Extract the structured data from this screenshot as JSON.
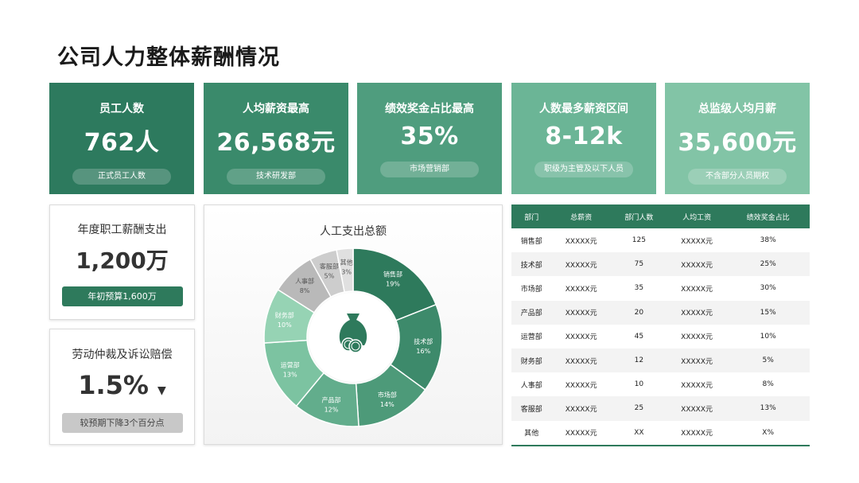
{
  "title": "公司人力整体薪酬情况",
  "kpis": [
    {
      "label": "员工人数",
      "value": "762人",
      "note": "正式员工人数",
      "color": "#2d7a5e"
    },
    {
      "label": "人均薪资最高",
      "value": "26,568元",
      "note": "技术研发部",
      "color": "#3a8a6b"
    },
    {
      "label": "绩效奖金占比最高",
      "value": "35%",
      "note": "市场营销部",
      "color": "#4f9d7e"
    },
    {
      "label": "人数最多薪资区间",
      "value": "8-12k",
      "note": "职级为主管及以下人员",
      "color": "#6bb596"
    },
    {
      "label": "总监级人均月薪",
      "value": "35,600元",
      "note": "不含部分人员期权",
      "color": "#82c4a6"
    }
  ],
  "annual": {
    "label": "年度职工薪酬支出",
    "value": "1,200万",
    "note": "年初预算1,600万"
  },
  "labor": {
    "label": "劳动仲裁及诉讼赔偿",
    "value": "1.5%",
    "arrow": "▼",
    "note": "较预期下降3个百分点"
  },
  "chart_data": {
    "type": "pie",
    "title": "人工支出总额",
    "categories": [
      "销售部",
      "技术部",
      "市场部",
      "产品部",
      "运营部",
      "财务部",
      "人事部",
      "客服部",
      "其他"
    ],
    "values": [
      19,
      16,
      14,
      12,
      13,
      10,
      8,
      5,
      3
    ],
    "labels": [
      "19%",
      "16%",
      "14%",
      "12%",
      "13%",
      "10%",
      "8%",
      "5%",
      "3%"
    ],
    "colors": [
      "#2e7a5c",
      "#3d8a6b",
      "#4d9a79",
      "#62ad8c",
      "#7cc3a1",
      "#96d3b4",
      "#b9b9b9",
      "#cdcdcd",
      "#e0e0e0"
    ],
    "center_icon": "money-bag-icon"
  },
  "table": {
    "headers": [
      "部门",
      "总薪资",
      "部门人数",
      "人均工资",
      "绩效奖金占比"
    ],
    "rows": [
      [
        "销售部",
        "XXXXX元",
        "125",
        "XXXXX元",
        "38%"
      ],
      [
        "技术部",
        "XXXXX元",
        "75",
        "XXXXX元",
        "25%"
      ],
      [
        "市场部",
        "XXXXX元",
        "35",
        "XXXXX元",
        "30%"
      ],
      [
        "产品部",
        "XXXXX元",
        "20",
        "XXXXX元",
        "15%"
      ],
      [
        "运营部",
        "XXXXX元",
        "45",
        "XXXXX元",
        "10%"
      ],
      [
        "财务部",
        "XXXXX元",
        "12",
        "XXXXX元",
        "5%"
      ],
      [
        "人事部",
        "XXXXX元",
        "10",
        "XXXXX元",
        "8%"
      ],
      [
        "客服部",
        "XXXXX元",
        "25",
        "XXXXX元",
        "13%"
      ],
      [
        "其他",
        "XXXXX元",
        "XX",
        "XXXXX元",
        "X%"
      ]
    ]
  }
}
